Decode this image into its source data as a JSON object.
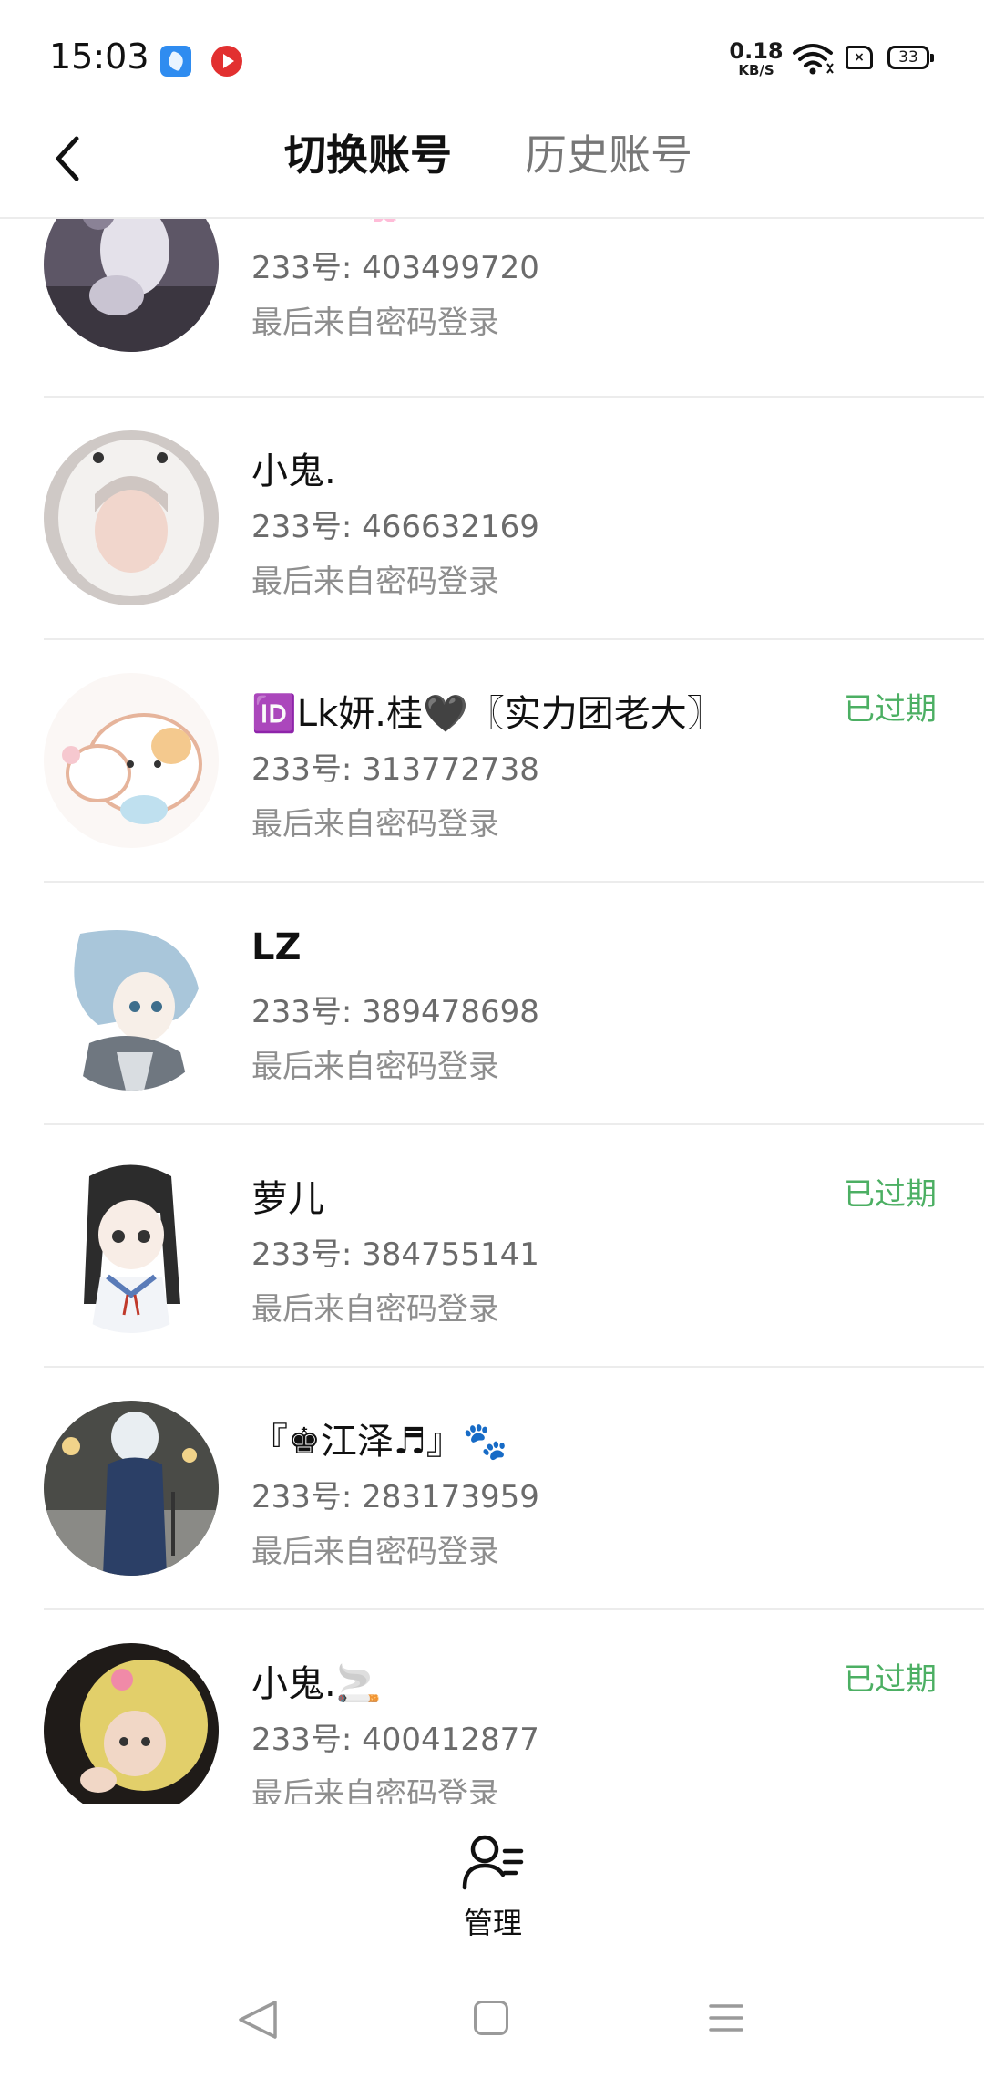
{
  "status_bar": {
    "time": "15:03",
    "net_speed_value": "0.18",
    "net_speed_unit": "KB/S",
    "sim_label": "×",
    "battery": "33",
    "icons": [
      "app-notification-icon",
      "video-app-icon",
      "wifi-icon",
      "sim-icon",
      "battery-icon"
    ]
  },
  "header": {
    "back_icon": "chevron-left-icon",
    "tabs": [
      {
        "label": "切换账号",
        "active": true
      },
      {
        "label": "历史账号",
        "active": false
      }
    ]
  },
  "accounts": [
    {
      "name": "李雪花🌸大小姐",
      "uid": "233号: 403499720",
      "login": "最后来自密码登录",
      "status": ""
    },
    {
      "name": "小鬼.",
      "uid": "233号: 466632169",
      "login": "最后来自密码登录",
      "status": ""
    },
    {
      "name": "🆔Lk妍.桂🖤〖实力团老大〗",
      "uid": "233号: 313772738",
      "login": "最后来自密码登录",
      "status": "已过期"
    },
    {
      "name": "LZ",
      "uid": "233号: 389478698",
      "login": "最后来自密码登录",
      "status": ""
    },
    {
      "name": "萝儿",
      "uid": "233号: 384755141",
      "login": "最后来自密码登录",
      "status": "已过期"
    },
    {
      "name": "『♚江泽♬』🐾",
      "uid": "233号: 283173959",
      "login": "最后来自密码登录",
      "status": ""
    },
    {
      "name": "小鬼.🚬",
      "uid": "233号: 400412877",
      "login": "最后来自密码登录",
      "status": "已过期"
    }
  ],
  "manage": {
    "label": "管理",
    "icon": "user-list-icon"
  },
  "nav": {
    "icons": [
      "nav-back-icon",
      "nav-home-icon",
      "nav-menu-icon"
    ]
  },
  "colors": {
    "expired": "#4caf63",
    "text_primary": "#111111",
    "text_secondary": "#6b6b6b"
  }
}
